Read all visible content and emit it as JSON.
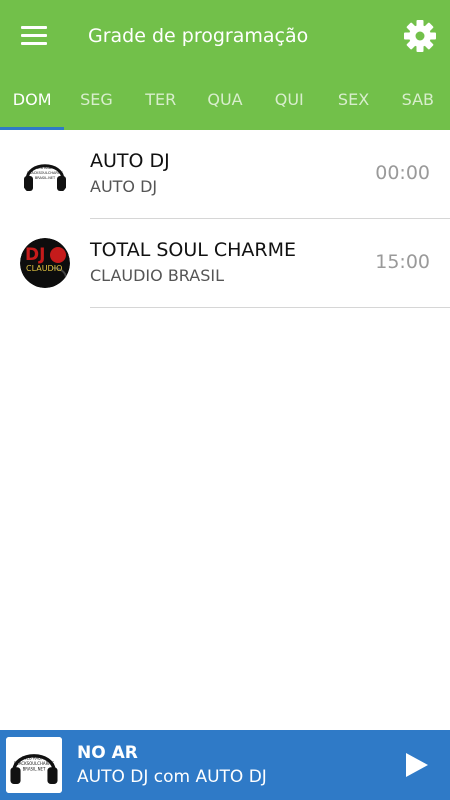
{
  "appbar": {
    "title": "Grade de programação",
    "menu_icon": "menu-icon",
    "settings_icon": "gear-icon",
    "color": "#72c04a"
  },
  "tabs": [
    {
      "label": "DOM",
      "active": true
    },
    {
      "label": "SEG",
      "active": false
    },
    {
      "label": "TER",
      "active": false
    },
    {
      "label": "QUA",
      "active": false
    },
    {
      "label": "QUI",
      "active": false
    },
    {
      "label": "SEX",
      "active": false
    },
    {
      "label": "SAB",
      "active": false
    }
  ],
  "schedule": [
    {
      "name": "AUTO DJ",
      "host": "AUTO DJ",
      "time": "00:00",
      "avatar_icon": "headphones-logo-icon"
    },
    {
      "name": "TOTAL SOUL CHARME",
      "host": "CLAUDIO BRASIL",
      "time": "15:00",
      "avatar_icon": "dj-claudio-logo-icon"
    }
  ],
  "player": {
    "label": "NO AR",
    "now_playing": "AUTO DJ com AUTO DJ",
    "play_icon": "play-icon",
    "color": "#2f7ac7"
  },
  "logo_text": {
    "headphones": [
      "WEB RADIO",
      "BLACKSOULCHARME",
      "BRASIL.NET"
    ],
    "dj": [
      "DJ",
      "CLAUDIO"
    ]
  }
}
